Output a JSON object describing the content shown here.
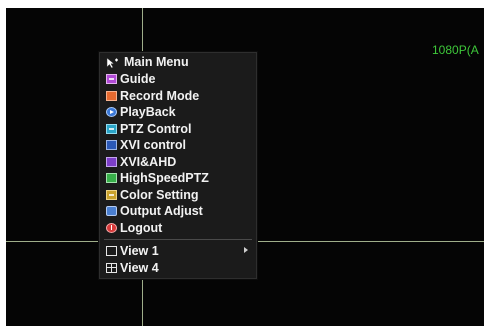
{
  "channel": {
    "resolution_label": "1080P(A"
  },
  "menu": {
    "title": "Main Menu",
    "title_icon": "mouse-cursor-icon",
    "items": [
      {
        "label": "Guide",
        "icon": "guide-icon",
        "color": "#b14ad6"
      },
      {
        "label": "Record Mode",
        "icon": "record-icon",
        "color": "#e66a30"
      },
      {
        "label": "PlayBack",
        "icon": "playback-icon",
        "color": "#3a78d8"
      },
      {
        "label": "PTZ Control",
        "icon": "ptz-icon",
        "color": "#2aa5c8"
      },
      {
        "label": "XVI control",
        "icon": "xvi-icon",
        "color": "#2b59b8"
      },
      {
        "label": "XVI&AHD",
        "icon": "xvi-ahd-icon",
        "color": "#7c3ec8"
      },
      {
        "label": "HighSpeedPTZ",
        "icon": "highspeed-ptz-icon",
        "color": "#38b04a"
      },
      {
        "label": "Color Setting",
        "icon": "color-setting-icon",
        "color": "#c9a22c"
      },
      {
        "label": "Output Adjust",
        "icon": "output-adjust-icon",
        "color": "#4a7fd0"
      },
      {
        "label": "Logout",
        "icon": "logout-icon",
        "color": "#d83a3a"
      }
    ],
    "view_items": [
      {
        "label": "View 1",
        "icon": "single-view-icon",
        "has_submenu": true
      },
      {
        "label": "View 4",
        "icon": "quad-view-icon",
        "has_submenu": false
      }
    ]
  },
  "colors": {
    "background": "#050505",
    "menu_background": "#1b1b1b",
    "menu_text": "#f2f2f2",
    "channel_label": "#3ec83a",
    "grid_lines": "#9fae8a"
  }
}
